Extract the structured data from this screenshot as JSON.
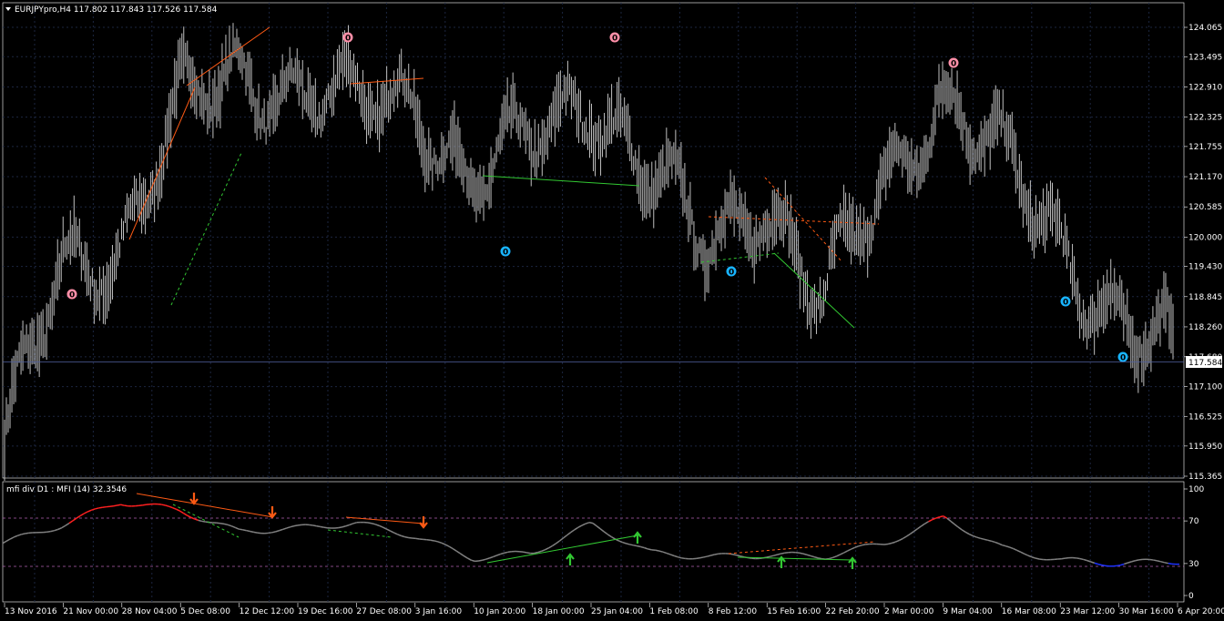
{
  "main_pane": {
    "symbol_label": "EURJPYpro,H4  117.802 117.843 117.526 117.584",
    "price_ticks": [
      "124.065",
      "123.495",
      "122.910",
      "122.325",
      "121.755",
      "121.170",
      "120.585",
      "120.000",
      "119.430",
      "118.845",
      "118.260",
      "117.680",
      "117.100",
      "116.525",
      "115.950",
      "115.365"
    ],
    "current_price": "117.584",
    "price_range": [
      115.365,
      124.065
    ]
  },
  "indicator_pane": {
    "label": "mfi div D1 : MFI (14) 32.3546",
    "scale_ticks": [
      "100",
      "70",
      "30",
      "0"
    ],
    "levels": [
      70,
      30
    ]
  },
  "time_axis": {
    "labels": [
      "13 Nov 2016",
      "21 Nov 00:00",
      "28 Nov 04:00",
      "5 Dec 08:00",
      "12 Dec 12:00",
      "19 Dec 16:00",
      "27 Dec 08:00",
      "3 Jan 16:00",
      "10 Jan 20:00",
      "18 Jan 00:00",
      "25 Jan 04:00",
      "1 Feb 08:00",
      "8 Feb 12:00",
      "15 Feb 16:00",
      "22 Feb 20:00",
      "2 Mar 00:00",
      "9 Mar 04:00",
      "16 Mar 08:00",
      "23 Mar 12:00",
      "30 Mar 16:00",
      "6 Apr 20:00"
    ]
  },
  "markers": {
    "glyph": "0",
    "top_color": "#ff8fa8",
    "bottom_color": "#18b4ff"
  },
  "colors": {
    "background": "#000000",
    "grid": "#1c2640",
    "bars": "#c0c0c0",
    "bearish_div": "#ff5a14",
    "bullish_div": "#32c832",
    "mfi_line": "#808080",
    "mfi_high": "#ff2020",
    "mfi_low": "#1e32ff",
    "level_line": "#b060b0"
  },
  "chart_data": {
    "type": "line",
    "title": "EURJPYpro,H4",
    "series": [
      {
        "name": "EURJPYpro",
        "x": [
          "13 Nov 2016",
          "21 Nov 00:00",
          "28 Nov 04:00",
          "5 Dec 08:00",
          "12 Dec 12:00",
          "19 Dec 16:00",
          "27 Dec 08:00",
          "3 Jan 16:00",
          "10 Jan 20:00",
          "18 Jan 00:00",
          "25 Jan 04:00",
          "1 Feb 08:00",
          "8 Feb 12:00",
          "15 Feb 16:00",
          "22 Feb 20:00",
          "2 Mar 00:00",
          "9 Mar 04:00",
          "16 Mar 08:00",
          "23 Mar 12:00",
          "30 Mar 16:00",
          "6 Apr 20:00"
        ],
        "values": [
          115.8,
          119.6,
          119.8,
          122.4,
          123.3,
          122.8,
          122.5,
          122.8,
          121.0,
          121.8,
          122.9,
          121.2,
          119.8,
          120.9,
          118.6,
          120.9,
          122.8,
          121.5,
          120.0,
          118.5,
          117.6
        ]
      },
      {
        "name": "MFI (14)",
        "x": [
          "13 Nov 2016",
          "21 Nov 00:00",
          "28 Nov 04:00",
          "5 Dec 08:00",
          "12 Dec 12:00",
          "19 Dec 16:00",
          "27 Dec 08:00",
          "3 Jan 16:00",
          "10 Jan 20:00",
          "18 Jan 00:00",
          "25 Jan 04:00",
          "1 Feb 08:00",
          "8 Feb 12:00",
          "15 Feb 16:00",
          "22 Feb 20:00",
          "2 Mar 00:00",
          "9 Mar 04:00",
          "16 Mar 08:00",
          "23 Mar 12:00",
          "30 Mar 16:00",
          "6 Apr 20:00"
        ],
        "values": [
          49,
          66,
          88,
          80,
          60,
          63,
          68,
          56,
          35,
          40,
          67,
          40,
          36,
          38,
          37,
          49,
          73,
          44,
          33,
          30,
          32.35
        ]
      }
    ],
    "ylim": [
      115.365,
      124.065
    ]
  }
}
